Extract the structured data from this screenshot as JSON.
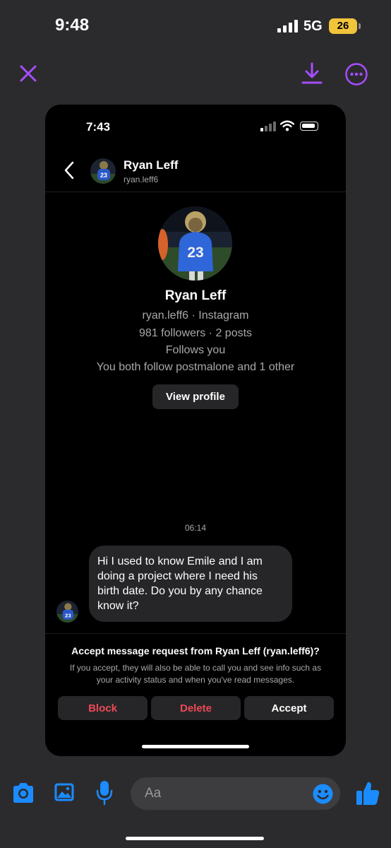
{
  "outer_status": {
    "time": "9:48",
    "network": "5G",
    "battery": "26"
  },
  "viewer": {
    "accent": "#a64dff"
  },
  "inner_status": {
    "time": "7:43"
  },
  "chat_header": {
    "name": "Ryan Leff",
    "handle": "ryan.leff6"
  },
  "profile": {
    "name": "Ryan Leff",
    "handle_platform": "ryan.leff6 · Instagram",
    "stats": "981 followers · 2 posts",
    "follows": "Follows you",
    "mutual": "You both follow postmalone and 1 other",
    "view_profile_label": "View profile",
    "jersey_number": "23"
  },
  "message": {
    "time": "06:14",
    "text": "Hi I used to know Emile and I am doing a project where I need his birth date. Do you by any chance know it?"
  },
  "request": {
    "title": "Accept message request from Ryan Leff (ryan.leff6)?",
    "description": "If you accept, they will also be able to call you and see info such as your activity status and when you've read messages.",
    "block_label": "Block",
    "delete_label": "Delete",
    "accept_label": "Accept",
    "danger_color": "#ed4956"
  },
  "composer": {
    "placeholder": "Aa",
    "accent": "#1a8cff"
  },
  "icons": [
    "close-icon",
    "download-icon",
    "more-icon",
    "back-icon",
    "camera-icon",
    "gallery-icon",
    "mic-icon",
    "emoji-icon",
    "thumbs-up-icon"
  ]
}
